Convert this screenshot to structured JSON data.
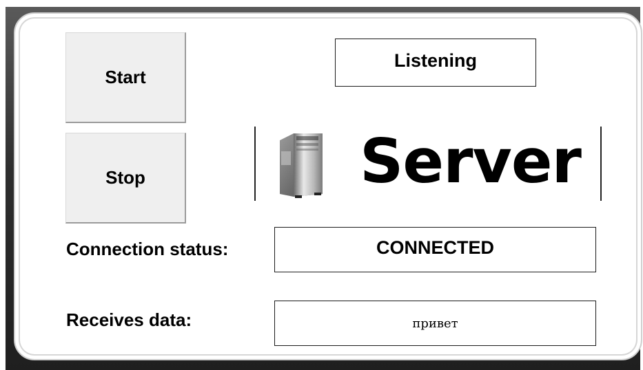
{
  "controls": {
    "start_label": "Start",
    "stop_label": "Stop"
  },
  "server": {
    "state": "Listening",
    "title": "Server",
    "icon": "server-tower-icon"
  },
  "connection": {
    "label": "Connection status:",
    "value": "CONNECTED"
  },
  "received": {
    "label": "Receives data:",
    "value": "привет"
  },
  "colors": {
    "frame": "#2e2e2e",
    "panel": "#ffffff",
    "button_bg": "#efefef",
    "text": "#000000"
  }
}
